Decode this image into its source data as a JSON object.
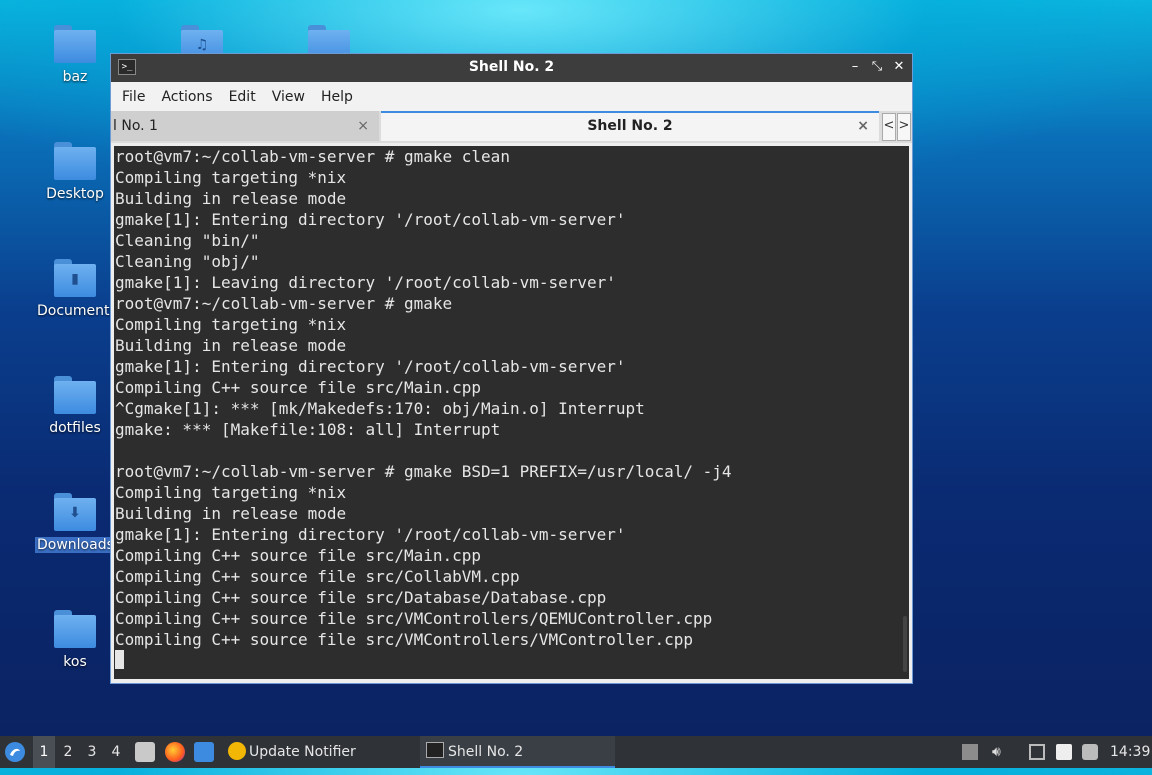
{
  "desktop": {
    "icons": [
      {
        "label": "baz"
      },
      {
        "label": ""
      },
      {
        "label": ""
      },
      {
        "label": "Desktop"
      },
      {
        "label": "Documents"
      },
      {
        "label": "dotfiles"
      },
      {
        "label": "Downloads"
      },
      {
        "label": "kos"
      }
    ]
  },
  "window": {
    "title": "Shell No. 2",
    "app_icon": ">_",
    "controls": {
      "minimize": "–",
      "maximize": "⤡",
      "close": "✕"
    }
  },
  "menu": {
    "file": "File",
    "actions": "Actions",
    "edit": "Edit",
    "view": "View",
    "help": "Help"
  },
  "tabs": [
    {
      "label": "l No. 1",
      "close": "×"
    },
    {
      "label": "Shell No. 2",
      "close": "×"
    }
  ],
  "tab_nav": {
    "prev": "<",
    "next": ">"
  },
  "terminal": {
    "lines": [
      "root@vm7:~/collab-vm-server # gmake clean",
      "Compiling targeting *nix",
      "Building in release mode",
      "gmake[1]: Entering directory '/root/collab-vm-server'",
      "Cleaning \"bin/\"",
      "Cleaning \"obj/\"",
      "gmake[1]: Leaving directory '/root/collab-vm-server'",
      "root@vm7:~/collab-vm-server # gmake",
      "Compiling targeting *nix",
      "Building in release mode",
      "gmake[1]: Entering directory '/root/collab-vm-server'",
      "Compiling C++ source file src/Main.cpp",
      "^Cgmake[1]: *** [mk/Makedefs:170: obj/Main.o] Interrupt",
      "gmake: *** [Makefile:108: all] Interrupt",
      "",
      "root@vm7:~/collab-vm-server # gmake BSD=1 PREFIX=/usr/local/ -j4",
      "Compiling targeting *nix",
      "Building in release mode",
      "gmake[1]: Entering directory '/root/collab-vm-server'",
      "Compiling C++ source file src/Main.cpp",
      "Compiling C++ source file src/CollabVM.cpp",
      "Compiling C++ source file src/Database/Database.cpp",
      "Compiling C++ source file src/VMControllers/QEMUController.cpp",
      "Compiling C++ source file src/VMControllers/VMController.cpp"
    ]
  },
  "taskbar": {
    "workspaces": [
      "1",
      "2",
      "3",
      "4"
    ],
    "active_workspace": "1",
    "tasks": [
      {
        "label": "Update Notifier"
      },
      {
        "label": "Shell No. 2"
      }
    ],
    "clock": "14:39"
  }
}
